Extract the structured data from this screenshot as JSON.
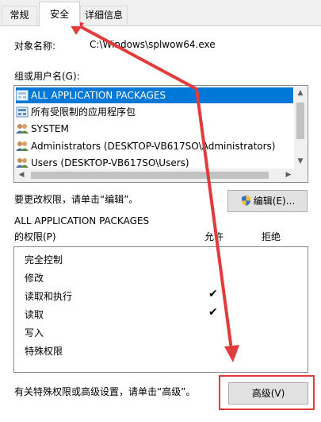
{
  "tabs": [
    {
      "label": "常规"
    },
    {
      "label": "安全"
    },
    {
      "label": "详细信息"
    }
  ],
  "object_name": {
    "label": "对象名称:",
    "value": "C:\\Windows\\splwow64.exe"
  },
  "group_label": "组或用户名(G):",
  "users": [
    {
      "name": "ALL APPLICATION PACKAGES",
      "icon": "package-icon"
    },
    {
      "name": "所有受限制的应用程序包",
      "icon": "package-icon"
    },
    {
      "name": "SYSTEM",
      "icon": "users-icon"
    },
    {
      "name": "Administrators (DESKTOP-VB617SO\\Administrators)",
      "icon": "users-icon"
    },
    {
      "name": "Users (DESKTOP-VB617SO\\Users)",
      "icon": "users-icon"
    }
  ],
  "edit_hint": "要更改权限，请单击“编辑”。",
  "edit_button": "编辑(E)...",
  "perm_title": "ALL APPLICATION PACKAGES",
  "perm_header": {
    "label": "的权限(P)",
    "allow": "允许",
    "deny": "拒绝"
  },
  "permissions": [
    {
      "name": "完全控制",
      "allow": false,
      "deny": false
    },
    {
      "name": "修改",
      "allow": false,
      "deny": false
    },
    {
      "name": "读取和执行",
      "allow": true,
      "deny": false
    },
    {
      "name": "读取",
      "allow": true,
      "deny": false
    },
    {
      "name": "写入",
      "allow": false,
      "deny": false
    },
    {
      "name": "特殊权限",
      "allow": false,
      "deny": false
    }
  ],
  "check_glyph": "✔",
  "advanced_hint": "有关特殊权限或高级设置，请单击“高级”。",
  "advanced_button": "高级(V)",
  "colors": {
    "selection": "#0078d7",
    "annotation": "#e23b3b"
  }
}
